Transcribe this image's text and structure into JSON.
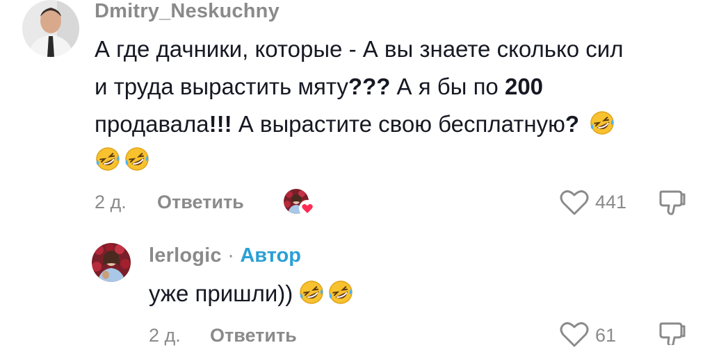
{
  "comments": [
    {
      "username": "Dmitry_Neskuchny",
      "text": {
        "line1": "А где дачники, которые - А вы знаете сколько сил",
        "line2": "и труда вырастить мяту",
        "line2_bold": "???",
        "line2_rest": " А я бы по ",
        "line2_num": "200",
        "line3": "продавала",
        "line3_bold": "!!!",
        "line3_rest": " А вырастите свою бесплатную",
        "line3_q": "?"
      },
      "emoji": "rolling-on-floor-laughing",
      "time": "2 д.",
      "reply_label": "Ответить",
      "likes": "441"
    },
    {
      "username": "lerlogic",
      "separator": "·",
      "author_badge": "Автор",
      "text": "уже пришли))",
      "emoji": "rolling-on-floor-laughing",
      "time": "2 д.",
      "reply_label": "Ответить",
      "likes": "61"
    }
  ],
  "colors": {
    "secondary_text": "#8a8a8a",
    "author_badge": "#2a9fd6",
    "primary_text": "#161823",
    "heart_badge": "#fe2c55"
  }
}
